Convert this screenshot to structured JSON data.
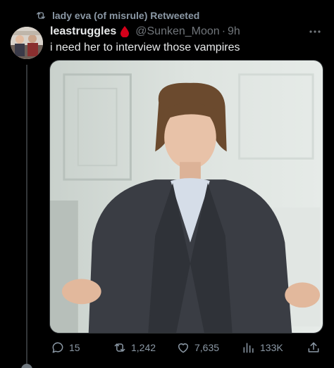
{
  "retweet_context": {
    "text": "lady eva (of misrule) Retweeted",
    "icon": "retweet-icon"
  },
  "tweet": {
    "display_name": "leastruggles",
    "name_emoji": "blood-drop-icon",
    "handle": "@Sunken_Moon",
    "separator": "·",
    "time": "9h",
    "text": "i need her to interview those vampires"
  },
  "actions": {
    "replies": "15",
    "retweets": "1,242",
    "likes": "7,635",
    "views": "133K"
  },
  "colors": {
    "background": "#000000",
    "text_primary": "#e7e9ea",
    "text_secondary": "#71767b",
    "icon_gray": "#8b98a5",
    "blood_drop": "#d4001a"
  }
}
